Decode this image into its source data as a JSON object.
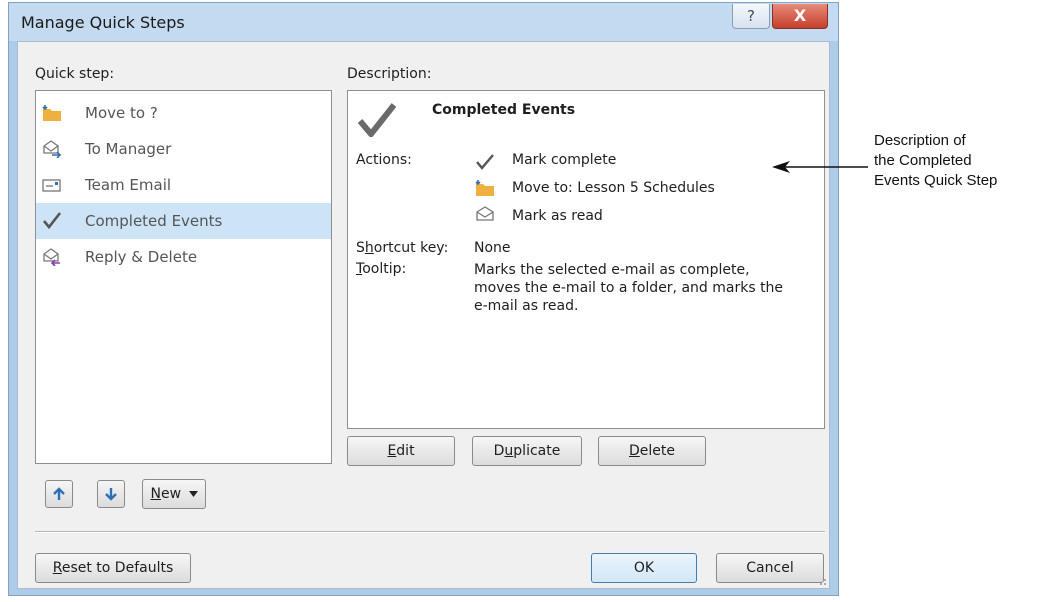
{
  "window": {
    "title": "Manage Quick Steps",
    "help_glyph": "?",
    "close_glyph": "X"
  },
  "quick_steps": {
    "label": "Quick step:",
    "items": [
      {
        "label": "Move to ?",
        "icon": "move-folder-icon",
        "selected": false
      },
      {
        "label": "To Manager",
        "icon": "forward-mail-icon",
        "selected": false
      },
      {
        "label": "Team Email",
        "icon": "email-card-icon",
        "selected": false
      },
      {
        "label": "Completed Events",
        "icon": "checkmark-icon",
        "selected": true
      },
      {
        "label": "Reply & Delete",
        "icon": "reply-delete-icon",
        "selected": false
      }
    ]
  },
  "description": {
    "label": "Description:",
    "heading": "Completed Events",
    "actions_label": "Actions:",
    "actions": [
      {
        "label": "Mark complete",
        "icon": "checkmark-icon"
      },
      {
        "label": "Move to: Lesson 5 Schedules",
        "icon": "move-folder-icon"
      },
      {
        "label": "Mark as read",
        "icon": "open-envelope-icon"
      }
    ],
    "shortcut_label_pre": "S",
    "shortcut_label_ul": "h",
    "shortcut_label_post": "ortcut key:",
    "shortcut_value": "None",
    "tooltip_label_ul": "T",
    "tooltip_label_post": "ooltip:",
    "tooltip_lines": [
      "Marks the selected e-mail as complete,",
      "moves the e-mail to a folder, and marks the",
      "e-mail as read."
    ]
  },
  "buttons": {
    "edit_ul": "E",
    "edit_rest": "dit",
    "duplicate_pre": "D",
    "duplicate_ul": "u",
    "duplicate_rest": "plicate",
    "delete_ul": "D",
    "delete_rest": "elete",
    "new_ul": "N",
    "new_rest": "ew",
    "reset_ul": "R",
    "reset_rest": "eset to Defaults",
    "ok": "OK",
    "cancel": "Cancel"
  },
  "annotation": {
    "lines": [
      "Description of",
      "the Completed",
      "Events Quick Step"
    ]
  },
  "colors": {
    "selected_row": "#cde4f7",
    "folder_orange": "#f0b040",
    "arrow_blue": "#2e6fb5"
  }
}
